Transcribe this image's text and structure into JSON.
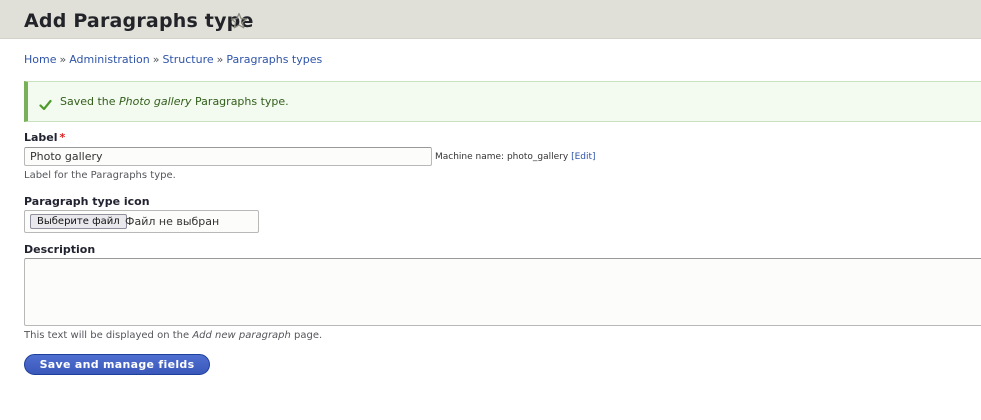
{
  "header": {
    "title": "Add Paragraphs type"
  },
  "breadcrumb": {
    "items": [
      "Home",
      "Administration",
      "Structure",
      "Paragraphs types"
    ],
    "separator": "»"
  },
  "message": {
    "prefix": "Saved the ",
    "emphasis": "Photo gallery",
    "suffix": " Paragraphs type.",
    "status_color": "#77b259"
  },
  "form": {
    "label_field": {
      "label": "Label",
      "required_mark": "*",
      "value": "Photo gallery",
      "machine_name_prefix": "Machine name: photo_gallery",
      "edit_open": "[",
      "edit_link": "Edit",
      "edit_close": "]",
      "help": "Label for the Paragraphs type."
    },
    "icon_field": {
      "label": "Paragraph type icon",
      "button_label": "Выберите файл",
      "status": "Файл не выбран"
    },
    "description_field": {
      "label": "Description",
      "value": "",
      "help_prefix": "This text will be displayed on the ",
      "help_emphasis": "Add new paragraph",
      "help_suffix": " page."
    },
    "submit_label": "Save and manage fields",
    "accent_color": "#3a58b9"
  }
}
